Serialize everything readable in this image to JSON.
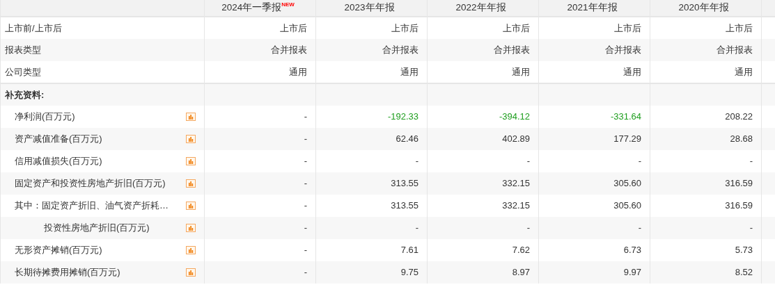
{
  "columns": [
    {
      "label": "2024年一季报",
      "badge": "NEW"
    },
    {
      "label": "2023年年报"
    },
    {
      "label": "2022年年报"
    },
    {
      "label": "2021年年报"
    },
    {
      "label": "2020年年报"
    }
  ],
  "rows": [
    {
      "kind": "info",
      "label": "上市前/上市后",
      "values": [
        {
          "text": "上市后"
        },
        {
          "text": "上市后"
        },
        {
          "text": "上市后"
        },
        {
          "text": "上市后"
        },
        {
          "text": "上市后"
        }
      ]
    },
    {
      "kind": "info",
      "label": "报表类型",
      "values": [
        {
          "text": "合并报表"
        },
        {
          "text": "合并报表"
        },
        {
          "text": "合并报表"
        },
        {
          "text": "合并报表"
        },
        {
          "text": "合并报表"
        }
      ]
    },
    {
      "kind": "info",
      "label": "公司类型",
      "values": [
        {
          "text": "通用"
        },
        {
          "text": "通用"
        },
        {
          "text": "通用"
        },
        {
          "text": "通用"
        },
        {
          "text": "通用"
        }
      ]
    },
    {
      "kind": "section",
      "label": "补充资料:"
    },
    {
      "kind": "metric",
      "label": "净利润(百万元)",
      "values": [
        {
          "text": "-"
        },
        {
          "text": "-192.33",
          "fall": true
        },
        {
          "text": "-394.12",
          "fall": true
        },
        {
          "text": "-331.64",
          "fall": true
        },
        {
          "text": "208.22"
        }
      ]
    },
    {
      "kind": "metric",
      "label": "资产减值准备(百万元)",
      "values": [
        {
          "text": "-"
        },
        {
          "text": "62.46"
        },
        {
          "text": "402.89"
        },
        {
          "text": "177.29"
        },
        {
          "text": "28.68"
        }
      ]
    },
    {
      "kind": "metric",
      "label": "信用减值损失(百万元)",
      "values": [
        {
          "text": "-"
        },
        {
          "text": "-"
        },
        {
          "text": "-"
        },
        {
          "text": "-"
        },
        {
          "text": "-"
        }
      ]
    },
    {
      "kind": "metric",
      "label": "固定资产和投资性房地产折旧(百万元)",
      "values": [
        {
          "text": "-"
        },
        {
          "text": "313.55"
        },
        {
          "text": "332.15"
        },
        {
          "text": "305.60"
        },
        {
          "text": "316.59"
        }
      ]
    },
    {
      "kind": "metric",
      "label": "其中：固定资产折旧、油气资产折耗…",
      "values": [
        {
          "text": "-"
        },
        {
          "text": "313.55"
        },
        {
          "text": "332.15"
        },
        {
          "text": "305.60"
        },
        {
          "text": "316.59"
        }
      ],
      "children": [
        {
          "kind": "metric",
          "label": "投资性房地产折旧(百万元)",
          "values": [
            {
              "text": "-"
            },
            {
              "text": "-"
            },
            {
              "text": "-"
            },
            {
              "text": "-"
            },
            {
              "text": "-"
            }
          ]
        }
      ]
    },
    {
      "kind": "metric",
      "label": "无形资产摊销(百万元)",
      "values": [
        {
          "text": "-"
        },
        {
          "text": "7.61"
        },
        {
          "text": "7.62"
        },
        {
          "text": "6.73"
        },
        {
          "text": "5.73"
        }
      ]
    },
    {
      "kind": "metric",
      "label": "长期待摊费用摊销(百万元)",
      "values": [
        {
          "text": "-"
        },
        {
          "text": "9.75"
        },
        {
          "text": "8.97"
        },
        {
          "text": "9.97"
        },
        {
          "text": "8.52"
        }
      ]
    }
  ]
}
